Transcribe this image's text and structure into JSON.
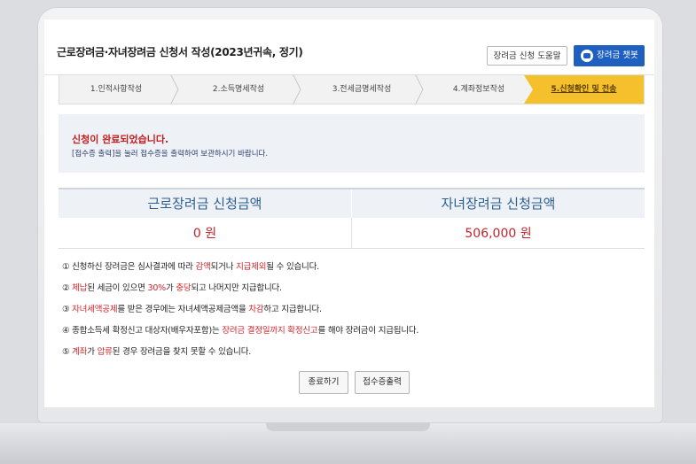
{
  "header": {
    "title": "근로장려금·자녀장려금 신청서 작성(2023년귀속, 정기)",
    "help_label": "장려금 신청 도움말",
    "chatbot_label": "장려금 챗봇"
  },
  "steps": [
    {
      "label": "1.인적사항작성"
    },
    {
      "label": "2.소득명세작성"
    },
    {
      "label": "3.전세금명세작성"
    },
    {
      "label": "4.계좌정보작성"
    },
    {
      "label": "5.신청확인 및 전송"
    }
  ],
  "active_step": 5,
  "notice": {
    "title": "신청이 완료되었습니다.",
    "subtitle": "[접수증 출력]을 눌러 접수증을 출력하여 보관하시기 바랍니다."
  },
  "amounts": {
    "earned_label": "근로장려금 신청금액",
    "earned_value": "0 원",
    "child_label": "자녀장려금 신청금액",
    "child_value": "506,000 원"
  },
  "notes": [
    [
      {
        "t": "① 신청하신 장려금은 심사결과에 따라 "
      },
      {
        "t": "감액",
        "hl": true
      },
      {
        "t": "되거나 "
      },
      {
        "t": "지급제외",
        "hl": true
      },
      {
        "t": "될 수 있습니다."
      }
    ],
    [
      {
        "t": "② "
      },
      {
        "t": "체납",
        "hl": true
      },
      {
        "t": "된 세금이 있으면 "
      },
      {
        "t": "30%",
        "hl": true
      },
      {
        "t": "가 "
      },
      {
        "t": "충당",
        "hl": true
      },
      {
        "t": "되고 나머지만 지급합니다."
      }
    ],
    [
      {
        "t": "③ "
      },
      {
        "t": "자녀세액공제",
        "hl": true
      },
      {
        "t": "를 받은 경우에는 자녀세액공제금액을 "
      },
      {
        "t": "차감",
        "hl": true
      },
      {
        "t": "하고 지급합니다."
      }
    ],
    [
      {
        "t": "④ 종합소득세 확정신고 대상자(배우자포함)는 "
      },
      {
        "t": "장려금 결정일까지 확정신고",
        "hl": true
      },
      {
        "t": "를 해야 장려금이 지급됩니다."
      }
    ],
    [
      {
        "t": "⑤ "
      },
      {
        "t": "계좌",
        "hl": true
      },
      {
        "t": "가 "
      },
      {
        "t": "압류",
        "hl": true
      },
      {
        "t": "된 경우 장려금을 찾지 못할 수 있습니다."
      }
    ]
  ],
  "buttons": {
    "close_label": "종료하기",
    "receipt_label": "접수증출력"
  },
  "colors": {
    "accent_blue": "#1f5fbf",
    "active_step": "#f4c12c",
    "highlight_red": "#d0252a"
  }
}
